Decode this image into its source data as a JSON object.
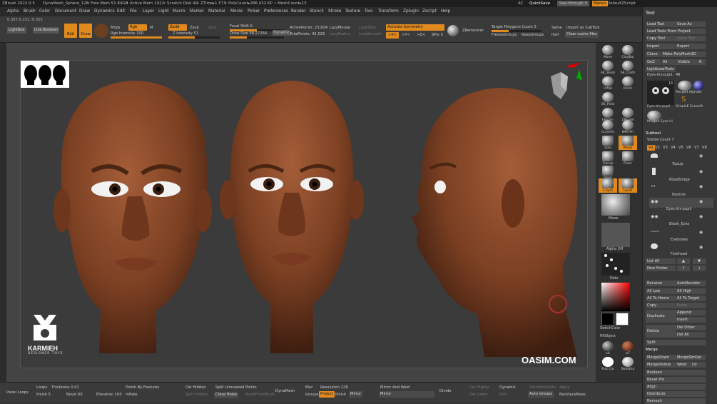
{
  "titlebar": {
    "app": "ZBrush 2022.0.5",
    "document": "DynaMesh_Sphere_128",
    "free_mem": "• Free Mem 51.84GB",
    "active_mem": "• Active Mem 1922",
    "scratch": "• Scratch Disk 49",
    "ztime": "• ZTime▸1.573",
    "polycount": "• PolyCount▸286.432 KP",
    "meshcount": "• MeshCount▸13",
    "ac": "AC",
    "quicksave": "QuickSave",
    "seethrough": "See-through  0",
    "menus": "Menus",
    "zscript": "DefaultZScript"
  },
  "menu": [
    "Alpha",
    "Brush",
    "Color",
    "Document",
    "Draw",
    "Dynamics",
    "Edit",
    "File",
    "Layer",
    "Light",
    "Macro",
    "Marker",
    "Material",
    "Movie",
    "Picker",
    "Preferences",
    "Render",
    "Stencil",
    "Stroke",
    "Texture",
    "Tool",
    "Transform",
    "Zplugin",
    "Zscript",
    "Help"
  ],
  "coords": "0.357,0.151,-0.355",
  "toolbar": {
    "lightbox": "LightBox",
    "live_boolean": "Live Boolean",
    "edit": "Edit",
    "draw": "Draw",
    "mrgb": "Mrgb",
    "rgb": "Rgb",
    "m": "M",
    "rgb_intensity": "Rgb Intensity 100",
    "zadd": "Zadd",
    "zsub": "Zsub",
    "zcut": "Zcut",
    "z_intensity": "Z Intensity 51",
    "focal_shift": "Focal Shift 0",
    "draw_size": "Draw Size 58.27256",
    "dynamic": "Dynamic",
    "active_points": "ActivePoints: 23,824",
    "total_points": "TotalPoints: 42,526",
    "lazymouse": "LazyMouse",
    "lazyradius": "LazyRadius",
    "lazystep": "LazyStep",
    "lazysmooth": "LazySmooth",
    "activate_symmetry": "Activate Symmetry",
    "sym_x": ">X<",
    "sym_y": ">Y<",
    "sym_z": ">Z<",
    "spix": "SPix 3",
    "zremesher": "ZRemesher",
    "target_polycount": "Target Polygons Count 5",
    "same": "Same",
    "half": "Half",
    "freezegroups": "FreezeGroups",
    "keepgroups": "KeepGroups",
    "import_subtool": "Import as SubTool",
    "clear_cache": "Clear cache files"
  },
  "shelf": [
    {
      "label": "Move"
    },
    {
      "label": "ClayBui"
    },
    {
      "label": "SK_Slash"
    },
    {
      "label": "SK_Cloth"
    },
    {
      "label": "Inflat"
    },
    {
      "label": "Pinch"
    },
    {
      "label": "SK_Polis"
    },
    {
      "label": ""
    },
    {
      "label": "hPolish"
    },
    {
      "label": "ZModel"
    },
    {
      "label": "CurveTu"
    },
    {
      "label": "IMM Pri"
    },
    {
      "label": "Solo"
    },
    {
      "label": "Persp"
    },
    {
      "label": "Transp"
    },
    {
      "label": "Floor"
    },
    {
      "label": "PolyF"
    },
    {
      "label": "L.Sym"
    },
    {
      "label": "Local"
    }
  ],
  "shelf_material": "Move",
  "shelf_alpha": "Alpha Off",
  "shelf_stroke": "Dots",
  "switch_color": "SwitchColor",
  "fill_object": "FillObject",
  "shelf_mat_x4": "x4",
  "shelf_mat_a7": "a7",
  "flat_col": "Flat Col",
  "skin_sha": "SkinSha",
  "watermark": {
    "brand": "KARMIEH",
    "sub": "DESIGNER TOYS",
    "site": "OASIM.COM"
  },
  "bottom": {
    "panel_loops": "Panel Loops",
    "loops": "Loops",
    "thickness": "Thickness 0.01",
    "polish": "Polish 5",
    "bevel": "Bevel 60",
    "polish_by_features": "Polish By Features",
    "elevation": "Elevation 100",
    "inflate": "Inflate",
    "del_hidden": "Del Hidden",
    "split_hidden": "Split Hidden",
    "split_unmasked": "Split Unmasked Points",
    "close_holes": "Close Holes",
    "meshfrombrush": "MeshFromBrush",
    "dynamesh": "DynaMesh",
    "blur": "Blur",
    "resolution": "Resolution 128",
    "groups": "Groups",
    "project": "Project",
    "polish_btn": "Polish",
    "mirror_weld": "Mirror And Weld",
    "mirror": "Mirror",
    "divide": "Divide",
    "del_higher": "Del Higher",
    "del_lower": "Del Lower",
    "dynamic": "Dynamic",
    "smt": "Smt",
    "smoothsubdiv": "SmoothSubdiv",
    "auto_groups": "Auto Groups",
    "apply": "Apply",
    "backfacemask": "BackfaceMask"
  },
  "tool": {
    "title": "Tool",
    "load_tool": "Load Tool",
    "save_as": "Save As",
    "load_from_project": "Load Tools From Project",
    "copy_tool": "Copy Tool",
    "paste_tool": "Paste Tool",
    "import": "Import",
    "export": "Export",
    "clone": "Clone",
    "make_polymesh": "Make PolyMesh3D",
    "goz": "GoZ",
    "all": "All",
    "visible": "Visible",
    "r": "R",
    "lightbox_tools": "Lightbox▸Tools",
    "eyes_label": "Eyes-Iris-pupil.",
    "eyes_count": "48",
    "thumb_count": "14",
    "merged_alpha": "Merged AlphaBr",
    "simple_eraser": "SimpleE EraserB",
    "merged_eyes": "Merged Eyes-Iri",
    "eyes_iris_small": "Eyes-Iris-pupil"
  },
  "subtool": {
    "title": "Subtool",
    "visible_count": "Visible Count 7",
    "tabs": [
      "V1",
      "V2",
      "V3",
      "V4",
      "V5",
      "V6",
      "V7",
      "V8"
    ],
    "items": [
      "TopLip",
      "NoseBridge",
      "Nostrils",
      "Eyes-Iris-pupil",
      "Blank_Eyes",
      "Eyebrows",
      "Forehead"
    ],
    "list_all": "List All",
    "new_folder": "New Folder",
    "rename": "Rename",
    "autoreorder": "AutoReorder",
    "all_low": "All Low",
    "all_high": "All High",
    "all_to_home": "All To Home",
    "all_to_target": "All To Target",
    "copy": "Copy",
    "paste": "Paste",
    "duplicate": "Duplicate",
    "append": "Append",
    "insert": "Insert",
    "delete": "Delete",
    "del_other": "Del Other",
    "del_all": "Del All",
    "split": "Split",
    "merge": "Merge",
    "mergedown": "MergeDown",
    "mergesimilar": "MergeSimilar",
    "mergevisible": "MergeVisible",
    "weld": "Weld",
    "uv": "Uv",
    "boolean": "Boolean",
    "bevel_pro": "Bevel Pro",
    "align": "Align",
    "distribute": "Distribute",
    "remesh": "Remesh"
  },
  "colors": {
    "accent": "#e08a1e",
    "skin": "#8a4a2a",
    "bg": "#3b3b3b"
  }
}
